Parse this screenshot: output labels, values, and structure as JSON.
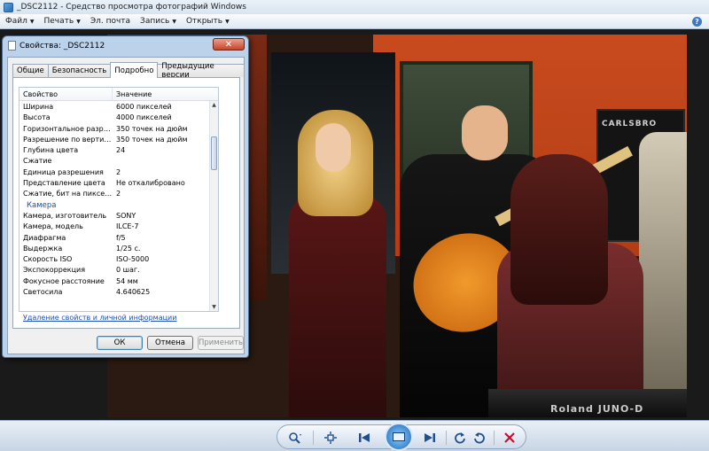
{
  "window": {
    "title": "_DSC2112 - Средство просмотра фотографий Windows"
  },
  "menu": {
    "file": "Файл",
    "print": "Печать",
    "email": "Эл. почта",
    "burn": "Запись",
    "open": "Открыть",
    "help": "?"
  },
  "photo": {
    "amp_label": "CARLSBRO",
    "keyboard_label": "Roland JUNO-D"
  },
  "dialog": {
    "title": "Свойства: _DSC2112",
    "close": "✕",
    "tabs": [
      "Общие",
      "Безопасность",
      "Подробно",
      "Предыдущие версии"
    ],
    "active_tab": "Подробно",
    "headers": {
      "property": "Свойство",
      "value": "Значение"
    },
    "rows": [
      {
        "name": "Ширина",
        "value": "6000 пикселей"
      },
      {
        "name": "Высота",
        "value": "4000 пикселей"
      },
      {
        "name": "Горизонтальное разреше...",
        "value": "350 точек на дюйм"
      },
      {
        "name": "Разрешение по вертикали",
        "value": "350 точек на дюйм"
      },
      {
        "name": "Глубина цвета",
        "value": "24"
      },
      {
        "name": "Сжатие",
        "value": ""
      },
      {
        "name": "Единица разрешения",
        "value": "2"
      },
      {
        "name": "Представление цвета",
        "value": "Не откалибровано"
      },
      {
        "name": "Сжатие, бит на пиксель",
        "value": "2"
      },
      {
        "name": "Камера",
        "value": "",
        "section": true
      },
      {
        "name": "Камера, изготовитель",
        "value": "SONY"
      },
      {
        "name": "Камера, модель",
        "value": "ILCE-7"
      },
      {
        "name": "Диафрагма",
        "value": "f/5"
      },
      {
        "name": "Выдержка",
        "value": "1/25 с."
      },
      {
        "name": "Скорость ISO",
        "value": "ISO-5000"
      },
      {
        "name": "Экспокоррекция",
        "value": "0 шаг."
      },
      {
        "name": "Фокусное расстояние",
        "value": "54 мм"
      },
      {
        "name": "Светосила",
        "value": "4.640625"
      }
    ],
    "remove_link": "Удаление свойств и личной информации",
    "buttons": {
      "ok": "ОК",
      "cancel": "Отмена",
      "apply": "Применить"
    }
  },
  "controls": {
    "zoom_icon": "zoom-icon",
    "fit_icon": "actual-size-icon",
    "prev_icon": "previous-icon",
    "slideshow_icon": "slideshow-icon",
    "next_icon": "next-icon",
    "rotate_ccw_icon": "rotate-ccw-icon",
    "rotate_cw_icon": "rotate-cw-icon",
    "delete_icon": "delete-icon"
  }
}
